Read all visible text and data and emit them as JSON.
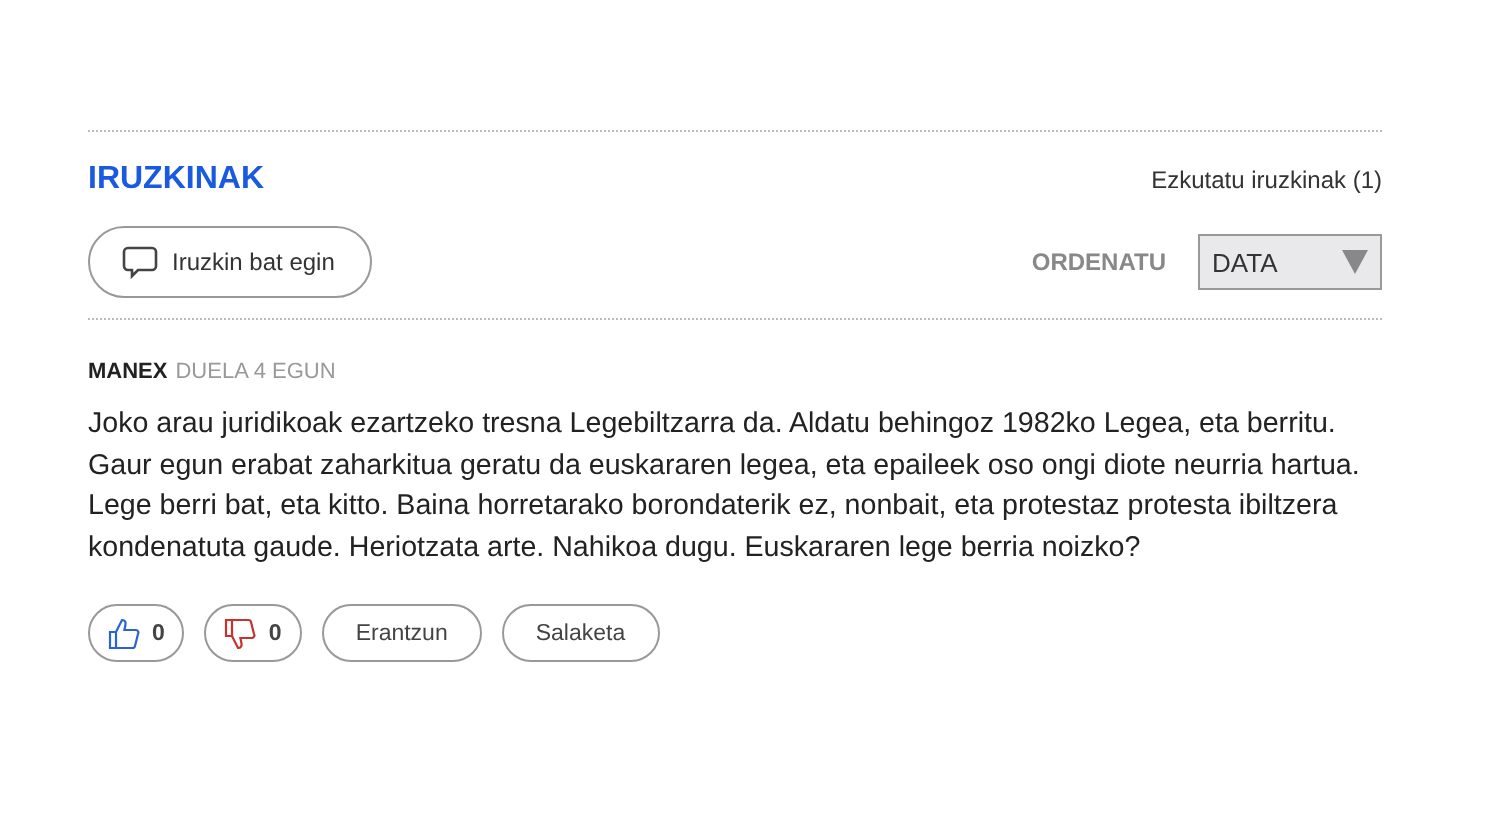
{
  "header": {
    "title": "IRUZKINAK",
    "hide_link": "Ezkutatu iruzkinak (1)"
  },
  "toolbar": {
    "comment_button": "Iruzkin bat egin",
    "sort_label": "ORDENATU",
    "sort_value": "DATA"
  },
  "comments": [
    {
      "author": "MANEX",
      "time": "DUELA 4 EGUN",
      "text": "Joko arau juridikoak ezartzeko tresna Legebiltzarra da. Aldatu behingoz 1982ko Legea, eta berritu. Gaur egun erabat zaharkitua geratu da euskararen legea, eta epaileek oso ongi diote neurria hartua. Lege berri bat, eta kitto. Baina horretarako borondaterik ez, nonbait, eta protestaz protesta ibiltzera kondenatuta gaude. Heriotzata arte. Nahikoa dugu. Euskararen lege berria noizko?",
      "likes": "0",
      "dislikes": "0",
      "reply": "Erantzun",
      "report": "Salaketa"
    }
  ]
}
